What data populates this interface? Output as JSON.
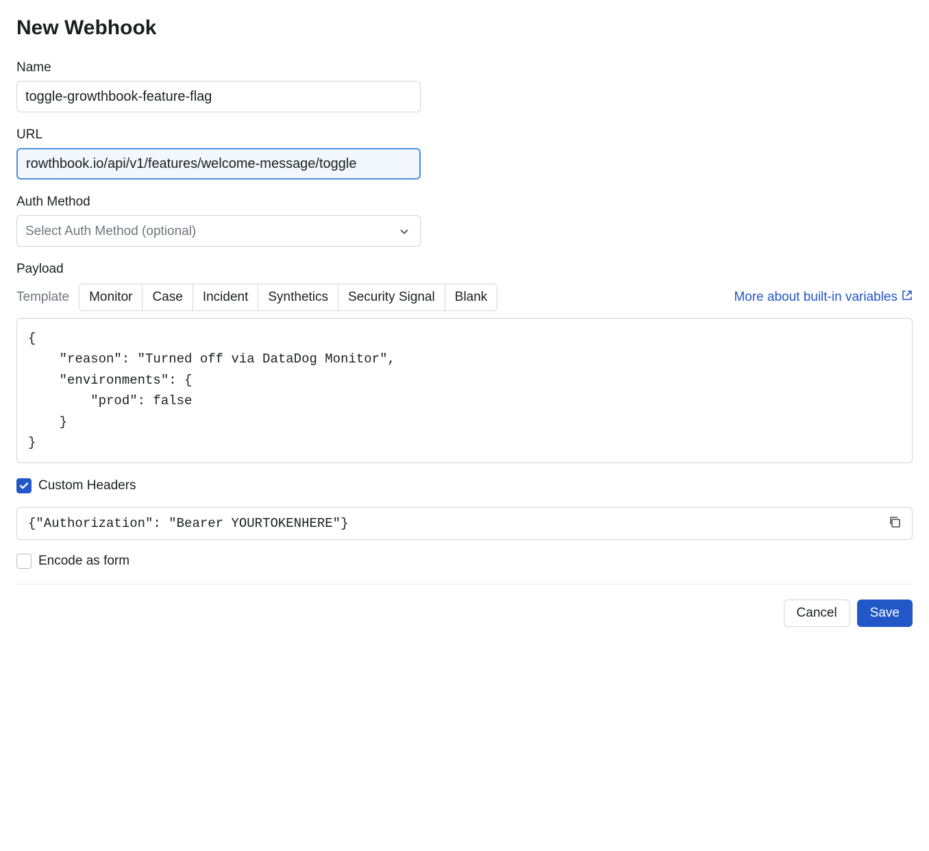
{
  "title": "New Webhook",
  "fields": {
    "name": {
      "label": "Name",
      "value": "toggle-growthbook-feature-flag"
    },
    "url": {
      "label": "URL",
      "value": "rowthbook.io/api/v1/features/welcome-message/toggle"
    },
    "auth_method": {
      "label": "Auth Method",
      "placeholder": "Select Auth Method (optional)"
    }
  },
  "payload": {
    "label": "Payload",
    "template_label": "Template",
    "tabs": [
      "Monitor",
      "Case",
      "Incident",
      "Synthetics",
      "Security Signal",
      "Blank"
    ],
    "more_link": "More about built-in variables",
    "code": "{\n    \"reason\": \"Turned off via DataDog Monitor\",\n    \"environments\": {\n        \"prod\": false\n    }\n}"
  },
  "custom_headers": {
    "label": "Custom Headers",
    "checked": true,
    "value": "{\"Authorization\": \"Bearer YOURTOKENHERE\"}"
  },
  "encode_as_form": {
    "label": "Encode as form",
    "checked": false
  },
  "footer": {
    "cancel": "Cancel",
    "save": "Save"
  }
}
